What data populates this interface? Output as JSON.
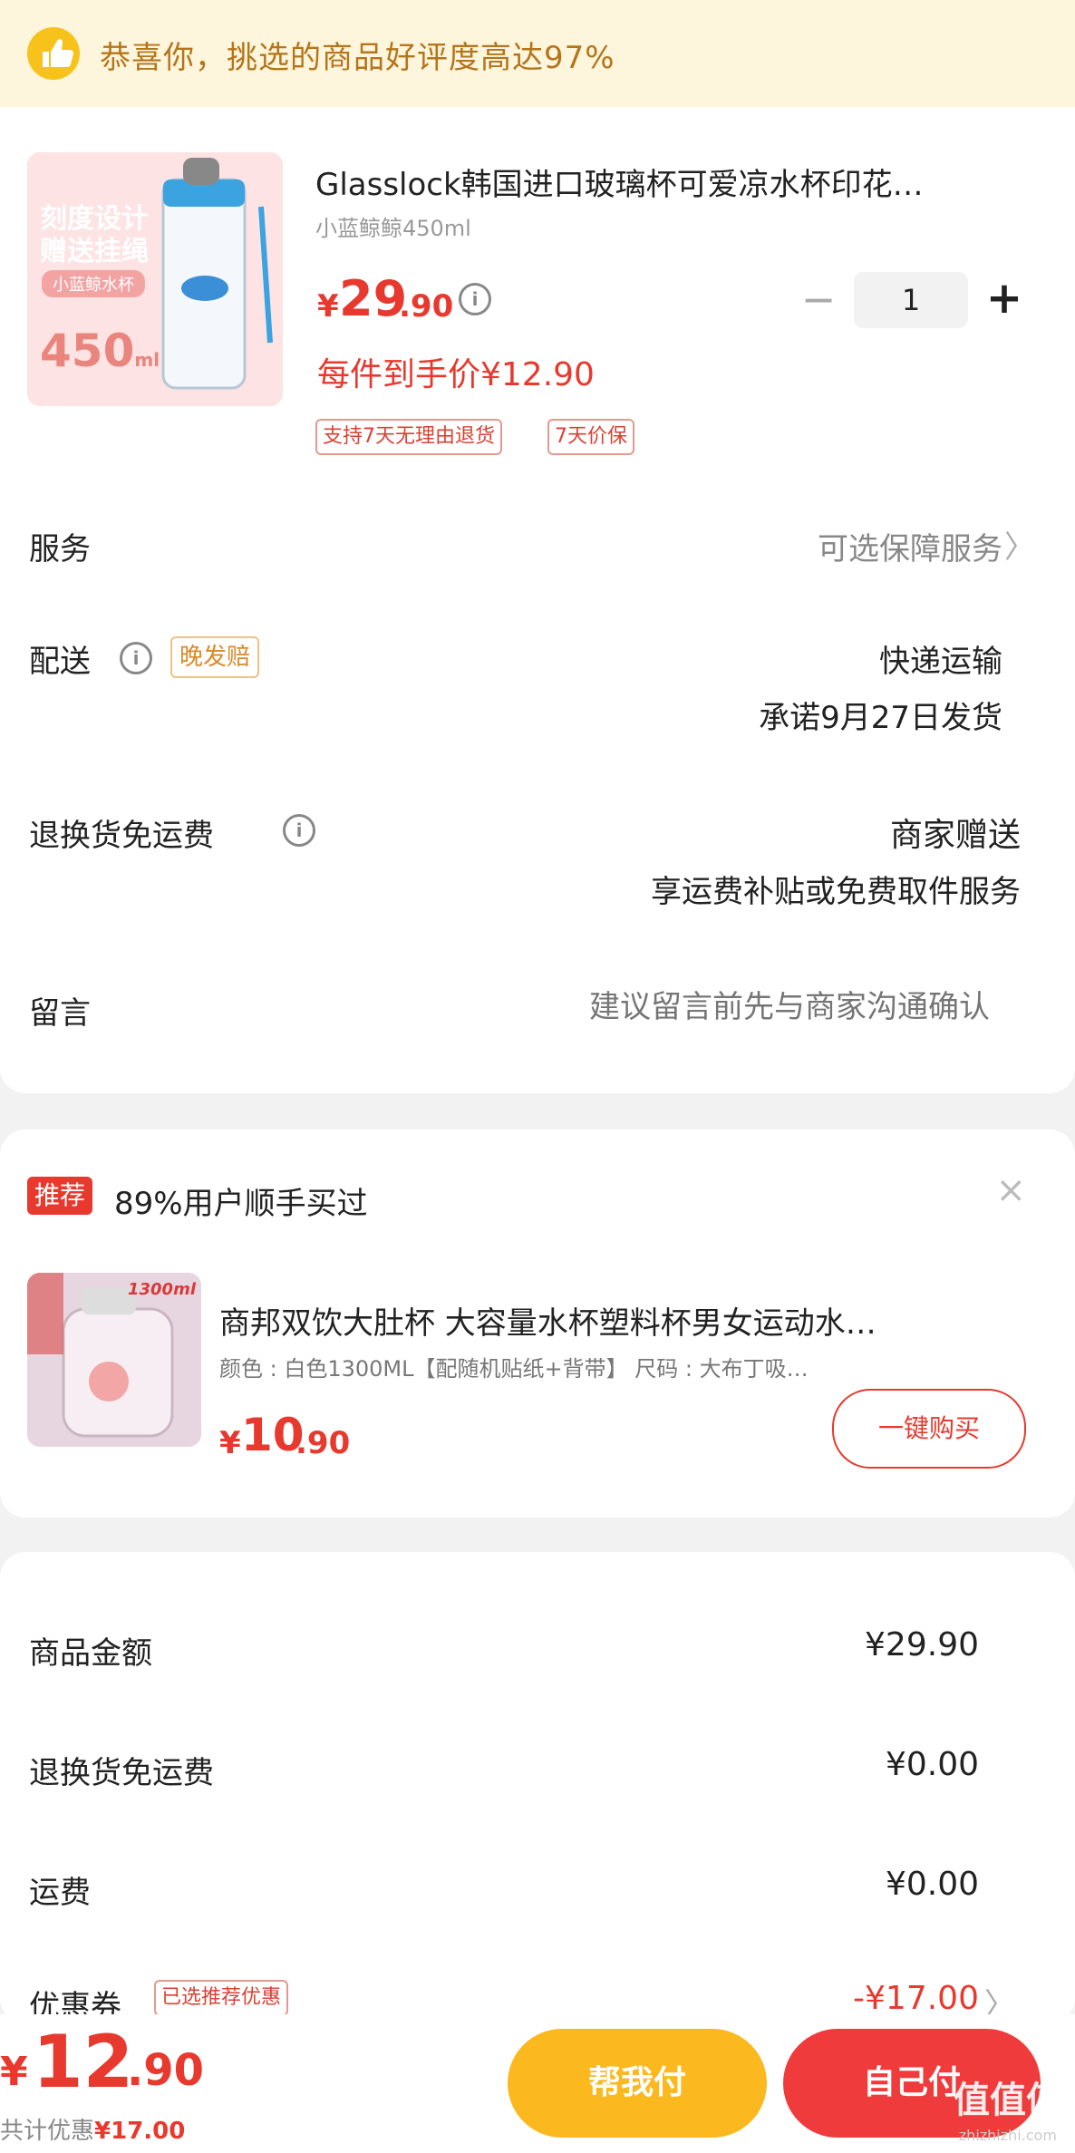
{
  "banner": {
    "text": "恭喜你，挑选的商品好评度高达97%"
  },
  "product": {
    "title": "Glasslock韩国进口玻璃杯可爱凉水杯印花…",
    "sku": "小蓝鲸鲸450ml",
    "image_text": {
      "line1": "刻度设计",
      "line2": "赠送挂绳",
      "badge": "小蓝鲸水杯",
      "volume": "450",
      "unit": "ml"
    },
    "price_symbol": "¥",
    "price_int": "29",
    "price_dec": ".90",
    "unit_price": "每件到手价¥12.90",
    "quantity": "1",
    "qty_minus": "−",
    "qty_plus": "+",
    "tags": [
      "支持7天无理由退货",
      "7天价保"
    ]
  },
  "rows": {
    "service": {
      "label": "服务",
      "value": "可选保障服务",
      "chevron": "〉"
    },
    "delivery": {
      "label": "配送",
      "badge": "晚发赔",
      "method": "快递运输",
      "promise": "承诺9月27日发货"
    },
    "return_shipping": {
      "label": "退换货免运费",
      "value_main": "商家赠送",
      "value_sub": "享运费补贴或免费取件服务"
    },
    "note": {
      "label": "留言",
      "placeholder": "建议留言前先与商家沟通确认"
    }
  },
  "recommend": {
    "badge": "推荐",
    "title": "89%用户顺手买过",
    "close": "×",
    "img_text": "1300ml",
    "name": "商邦双饮大肚杯  大容量水杯塑料杯男女运动水…",
    "spec": "颜色 : 白色1300ML【配随机贴纸+背带】     尺码 : 大布丁吸…",
    "price_symbol": "¥",
    "price_int": "10",
    "price_dec": ".90",
    "buy_label": "一键购买"
  },
  "summary": [
    {
      "label": "商品金额",
      "value": "¥29.90"
    },
    {
      "label": "退换货免运费",
      "value": "¥0.00"
    },
    {
      "label": "运费",
      "value": "¥0.00"
    },
    {
      "label": "优惠券",
      "tag": "已选推荐优惠",
      "value": "-¥17.00",
      "chevron": "〉"
    }
  ],
  "bottom": {
    "total_symbol": "¥",
    "total_int": "12",
    "total_dec": ".90",
    "discount_label": "共计优惠",
    "discount_value": "¥17.00",
    "pay_for_me": "帮我付",
    "pay_self": "自己付",
    "watermark": "值值值",
    "watermark_sub": "zhizhizhi.com"
  },
  "colors": {
    "accent": "#e8392e",
    "banner_bg": "#fdf5dc",
    "yellow_button": "#fbb81f"
  },
  "icons": [
    "thumbs-up-icon",
    "info-icon",
    "chevron-right-icon",
    "close-icon"
  ]
}
